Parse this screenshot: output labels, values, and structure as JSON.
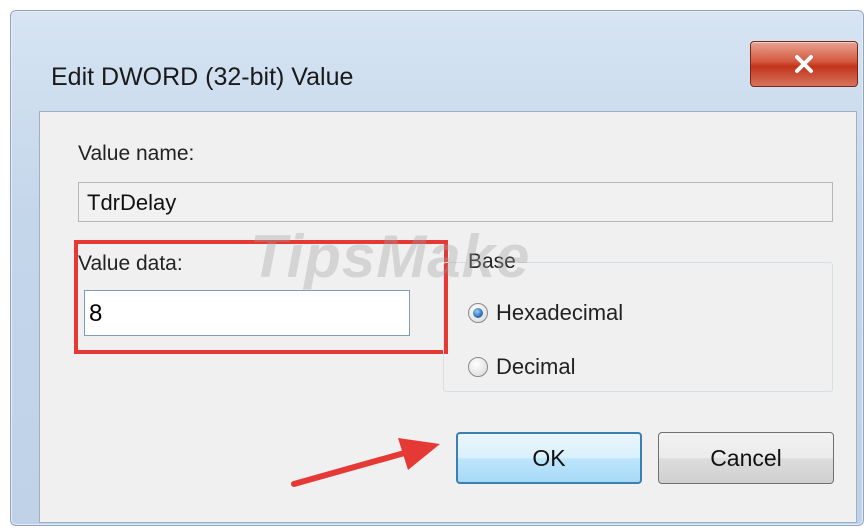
{
  "dialog": {
    "title": "Edit DWORD (32-bit) Value",
    "value_name_label": "Value name:",
    "value_name": "TdrDelay",
    "value_data_label": "Value data:",
    "value_data": "8",
    "base_label": "Base",
    "base_options": [
      {
        "label": "Hexadecimal",
        "selected": true
      },
      {
        "label": "Decimal",
        "selected": false
      }
    ],
    "ok_label": "OK",
    "cancel_label": "Cancel"
  },
  "watermark": "TipsMake",
  "colors": {
    "highlight": "#e53935",
    "arrow": "#e53935",
    "close_button": "#c2331b"
  },
  "icons": {
    "close": "close-icon",
    "arrow": "red-pointer-arrow"
  }
}
